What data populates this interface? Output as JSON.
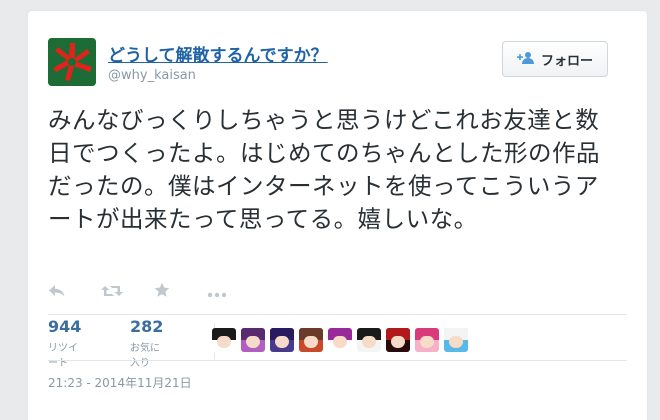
{
  "user": {
    "display_name": "どうして解散するんですか？",
    "handle": "@why_kaisan",
    "avatar_color": "#1d6b35",
    "avatar_mark_color": "#e0231b"
  },
  "follow_button": {
    "label": "フォロー",
    "icon": "add-user-icon"
  },
  "tweet": {
    "text": "みんなびっくりしちゃうと思うけどこれお友達と数日でつくったよ。はじめてのちゃんとした形の作品だったの。僕はインターネットを使ってこういうアートが出来たって思ってる。嬉しいな。",
    "timestamp": "21:23 - 2014年11月21日"
  },
  "actions": [
    {
      "name": "reply",
      "icon": "reply-icon"
    },
    {
      "name": "retweet",
      "icon": "retweet-icon"
    },
    {
      "name": "favorite",
      "icon": "star-icon"
    },
    {
      "name": "more",
      "icon": "more-icon"
    }
  ],
  "stats": {
    "retweets": {
      "count": "944",
      "label": "リツイート"
    },
    "favorites": {
      "count": "282",
      "label": "お気に入り"
    }
  },
  "favoriter_avatars": [
    {
      "hair": "#1a1a1a",
      "bg": "#ffffff"
    },
    {
      "hair": "#5a2a6e",
      "bg": "#b05fc0"
    },
    {
      "hair": "#2a1a5e",
      "bg": "#4a3a8e"
    },
    {
      "hair": "#6a3a2a",
      "bg": "#c84a2a"
    },
    {
      "hair": "#9a2a9a",
      "bg": "#ffffff"
    },
    {
      "hair": "#1a1a1a",
      "bg": "#f4f4f4"
    },
    {
      "hair": "#b01a1a",
      "bg": "#2a0a0a"
    },
    {
      "hair": "#d83a7a",
      "bg": "#f6b0c8"
    },
    {
      "hair": "#f4f4f4",
      "bg": "#58b8e8"
    }
  ]
}
